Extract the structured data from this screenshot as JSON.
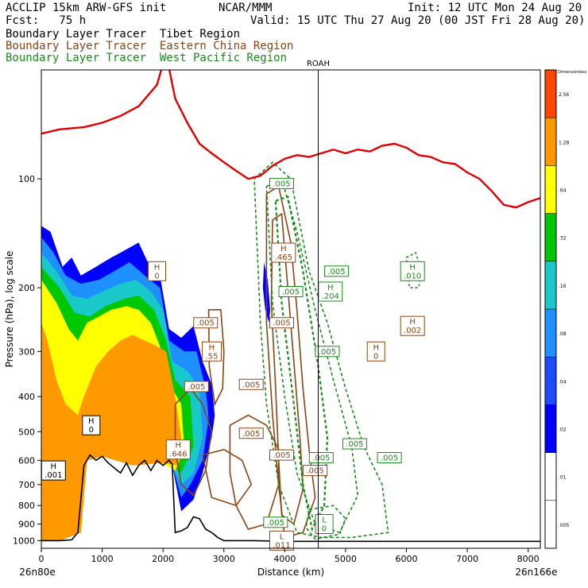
{
  "header": {
    "model": "ACCLIP 15km ARW-GFS init",
    "center": "NCAR/MMM",
    "init": "Init: 12 UTC Mon 24 Aug 20",
    "forecast": "Fcst:   75 h",
    "valid": "Valid: 15 UTC Thu 27 Aug 20 (00 JST Fri 28 Aug 20)",
    "tracer_tibet": "Boundary Layer Tracer  Tibet Region",
    "tracer_china": "Boundary Layer Tracer  Eastern China Region",
    "tracer_wpac": "Boundary Layer Tracer  West Pacific Region"
  },
  "colors": {
    "tibet_text": "#000000",
    "china": "#8b4513",
    "wpac": "#1a8a1a",
    "tropopause": "#e00000",
    "terrain": "#000000"
  },
  "chart_data": {
    "type": "cross-section",
    "xlabel": "Distance (km)",
    "ylabel": "Pressure (hPa), log scale",
    "xlim": [
      0,
      8200
    ],
    "ylim": [
      1050,
      50
    ],
    "y_scale": "log",
    "x_ticks": [
      0,
      1000,
      2000,
      3000,
      4000,
      5000,
      6000,
      7000,
      8000
    ],
    "y_ticks": [
      100,
      200,
      300,
      400,
      500,
      600,
      700,
      800,
      900,
      1000
    ],
    "left_endpoint": "26n80e",
    "right_endpoint": "26n166e",
    "marker": {
      "label": "ROAH",
      "x": 4550
    },
    "colorbar": {
      "levels": [
        ".005",
        ".01",
        ".02",
        ".04",
        ".08",
        ".16",
        ".32",
        ".64",
        "1.28",
        "2.56"
      ],
      "top_label": "Dimensionless",
      "colors": [
        "#ffffff",
        "#ffffff",
        "#0000ff",
        "#1e4bff",
        "#1e90ff",
        "#19c8c8",
        "#00c800",
        "#ffff00",
        "#ff9900",
        "#ff4500"
      ]
    },
    "tropopause": {
      "x": [
        0,
        300,
        700,
        1000,
        1300,
        1600,
        1900,
        2050,
        2200,
        2400,
        2600,
        2800,
        3000,
        3200,
        3400,
        3600,
        3800,
        4000,
        4200,
        4400,
        4600,
        4800,
        5000,
        5200,
        5400,
        5600,
        5800,
        6000,
        6200,
        6400,
        6600,
        6800,
        7000,
        7200,
        7400,
        7600,
        7800,
        8000,
        8200
      ],
      "p": [
        75,
        73,
        72,
        70,
        67,
        63,
        55,
        45,
        60,
        70,
        80,
        85,
        90,
        95,
        100,
        98,
        92,
        88,
        86,
        87,
        85,
        83,
        85,
        83,
        84,
        81,
        80,
        82,
        86,
        87,
        90,
        91,
        96,
        100,
        108,
        118,
        120,
        116,
        113
      ]
    },
    "terrain": {
      "x": [
        0,
        100,
        300,
        500,
        600,
        700,
        800,
        900,
        1000,
        1100,
        1200,
        1300,
        1400,
        1500,
        1600,
        1700,
        1800,
        1900,
        2000,
        2100,
        2150,
        2200,
        2300,
        2400,
        2500,
        2600,
        2700,
        2800,
        2900,
        3000,
        3500,
        4000,
        4500,
        5000,
        6000,
        7000,
        8000,
        8200
      ],
      "p": [
        1000,
        1000,
        1000,
        995,
        950,
        620,
        580,
        600,
        585,
        610,
        630,
        650,
        610,
        660,
        620,
        600,
        640,
        600,
        620,
        600,
        615,
        950,
        940,
        920,
        860,
        870,
        930,
        950,
        980,
        1000,
        1000,
        1005,
        1005,
        1005,
        1005,
        1005,
        1005,
        1005
      ]
    },
    "tibet_tracer": [
      {
        "level": "1.28",
        "x_range": [
          0,
          2800
        ],
        "p_range": [
          110,
          980
        ]
      },
      {
        "level": ".64",
        "x_range": [
          600,
          2200
        ],
        "p_range": [
          200,
          700
        ]
      },
      {
        "level": ".32",
        "x_range": [
          150,
          1900
        ],
        "p_range": [
          220,
          520
        ]
      },
      {
        "level": ".01",
        "x_range": [
          3640,
          3740
        ],
        "p_range": [
          170,
          240
        ]
      }
    ],
    "annotations": [
      {
        "text": "H",
        "sub": ".001",
        "x": 200,
        "p": 640,
        "series": "tibet"
      },
      {
        "text": "H",
        "sub": "0",
        "x": 820,
        "p": 480,
        "series": "tibet"
      },
      {
        "text": "H",
        "sub": "0",
        "x": 1900,
        "p": 180,
        "series": "china"
      },
      {
        "text": "",
        "sub": ".005",
        "x": 2700,
        "p": 250,
        "series": "china"
      },
      {
        "text": "H",
        "sub": ".55",
        "x": 2800,
        "p": 300,
        "series": "china"
      },
      {
        "text": "",
        "sub": ".005",
        "x": 2550,
        "p": 375,
        "series": "china"
      },
      {
        "text": "H",
        "sub": ".646",
        "x": 2250,
        "p": 560,
        "series": "china"
      },
      {
        "text": "",
        "sub": ".005",
        "x": 3950,
        "p": 103,
        "series": "wpac"
      },
      {
        "text": "H",
        "sub": ".465",
        "x": 3980,
        "p": 160,
        "series": "china"
      },
      {
        "text": "",
        "sub": ".005",
        "x": 4100,
        "p": 205,
        "series": "wpac"
      },
      {
        "text": "",
        "sub": ".005",
        "x": 3950,
        "p": 250,
        "series": "china"
      },
      {
        "text": "",
        "sub": ".005",
        "x": 3450,
        "p": 370,
        "series": "china"
      },
      {
        "text": "",
        "sub": ".005",
        "x": 3450,
        "p": 505,
        "series": "china"
      },
      {
        "text": "",
        "sub": ".005",
        "x": 3950,
        "p": 580,
        "series": "china"
      },
      {
        "text": "",
        "sub": ".005",
        "x": 4700,
        "p": 300,
        "series": "wpac"
      },
      {
        "text": "",
        "sub": ".005",
        "x": 4850,
        "p": 180,
        "series": "wpac"
      },
      {
        "text": "H",
        "sub": ".204",
        "x": 4750,
        "p": 205,
        "series": "wpac"
      },
      {
        "text": "H",
        "sub": ".010",
        "x": 6100,
        "p": 180,
        "series": "wpac"
      },
      {
        "text": "H",
        "sub": ".002",
        "x": 6100,
        "p": 255,
        "series": "china"
      },
      {
        "text": "H",
        "sub": "0",
        "x": 5500,
        "p": 300,
        "series": "china"
      },
      {
        "text": "",
        "sub": ".005",
        "x": 5150,
        "p": 540,
        "series": "wpac"
      },
      {
        "text": "",
        "sub": ".005",
        "x": 4600,
        "p": 590,
        "series": "wpac"
      },
      {
        "text": "",
        "sub": ".005",
        "x": 4500,
        "p": 640,
        "series": "china"
      },
      {
        "text": "",
        "sub": ".005",
        "x": 5720,
        "p": 590,
        "series": "wpac"
      },
      {
        "text": "L",
        "sub": "0",
        "x": 4650,
        "p": 900,
        "series": "wpac"
      },
      {
        "text": "L",
        "sub": ".011",
        "x": 3950,
        "p": 1000,
        "series": "china"
      },
      {
        "text": "",
        "sub": ".005",
        "x": 3850,
        "p": 890,
        "series": "wpac"
      }
    ]
  }
}
